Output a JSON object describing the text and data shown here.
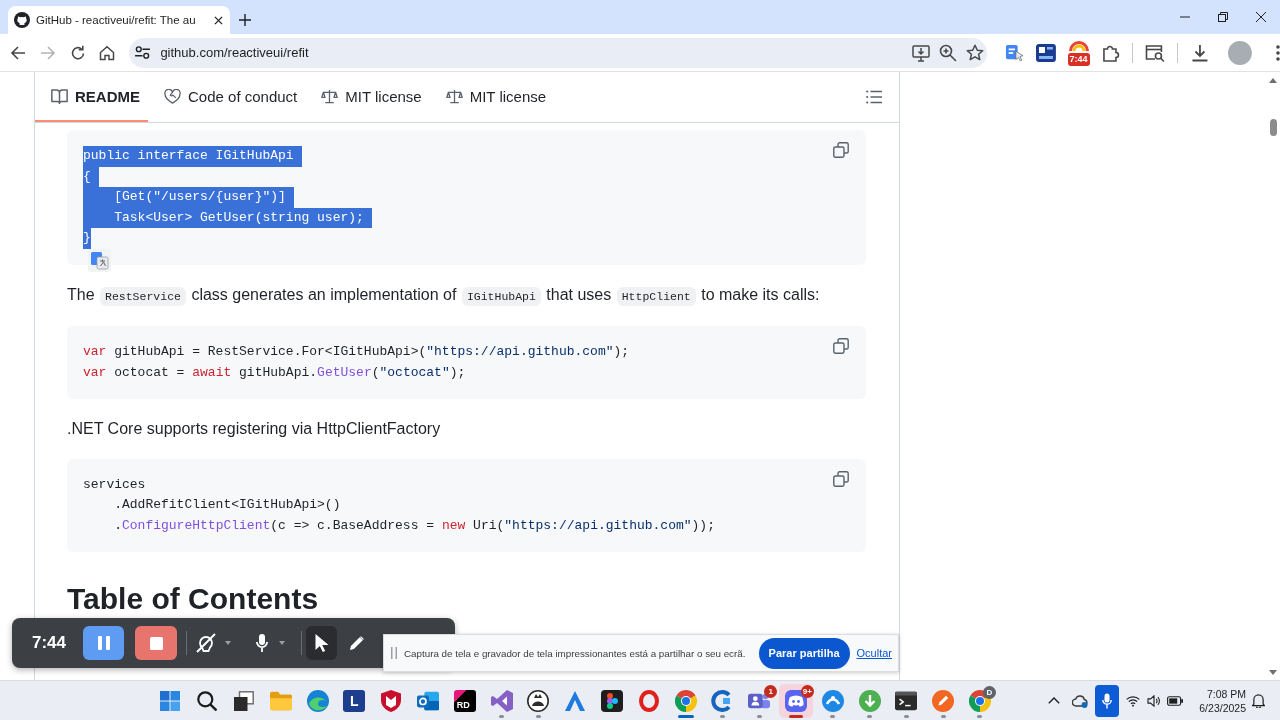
{
  "browser": {
    "tab": {
      "title": "GitHub - reactiveui/refit: The au",
      "selected": true
    },
    "address": "github.com/reactiveui/refit",
    "extension_badge": "7:44"
  },
  "readme": {
    "tabs": [
      {
        "kind": "readme",
        "label": "README",
        "selected": true
      },
      {
        "kind": "conduct",
        "label": "Code of conduct",
        "selected": false
      },
      {
        "kind": "license",
        "label": "MIT license",
        "selected": false
      },
      {
        "kind": "license",
        "label": "MIT license",
        "selected": false
      }
    ],
    "blocks": [
      {
        "kind": "code",
        "highlighted": true,
        "lines": [
          [
            {
              "kind": "plain",
              "text": "public interface IGitHubApi"
            }
          ],
          [
            {
              "kind": "plain",
              "text": "{"
            }
          ],
          [
            {
              "kind": "plain",
              "text": "    [Get(\"/users/{user}\")]"
            }
          ],
          [
            {
              "kind": "plain",
              "text": "    Task<User> GetUser(string user);"
            }
          ],
          [
            {
              "kind": "plain",
              "text": "}"
            }
          ]
        ]
      },
      {
        "kind": "paragraph",
        "segments": [
          {
            "kind": "text",
            "text": "The "
          },
          {
            "kind": "code",
            "text": "RestService"
          },
          {
            "kind": "text",
            "text": " class generates an implementation of "
          },
          {
            "kind": "code",
            "text": "IGitHubApi"
          },
          {
            "kind": "text",
            "text": " that uses "
          },
          {
            "kind": "code",
            "text": "HttpClient"
          },
          {
            "kind": "text",
            "text": " to make its calls:"
          }
        ]
      },
      {
        "kind": "code",
        "highlighted": false,
        "lines": [
          [
            {
              "kind": "keyword",
              "text": "var"
            },
            {
              "kind": "plain",
              "text": " gitHubApi = RestService.For<IGitHubApi>("
            },
            {
              "kind": "string",
              "text": "\"https://api.github.com\""
            },
            {
              "kind": "plain",
              "text": ");"
            }
          ],
          [
            {
              "kind": "keyword",
              "text": "var"
            },
            {
              "kind": "plain",
              "text": " octocat = "
            },
            {
              "kind": "keyword",
              "text": "await"
            },
            {
              "kind": "plain",
              "text": " gitHubApi."
            },
            {
              "kind": "function",
              "text": "GetUser"
            },
            {
              "kind": "plain",
              "text": "("
            },
            {
              "kind": "string",
              "text": "\"octocat\""
            },
            {
              "kind": "plain",
              "text": ");"
            }
          ]
        ]
      },
      {
        "kind": "paragraph",
        "segments": [
          {
            "kind": "text",
            "text": ".NET Core supports registering via HttpClientFactory"
          }
        ]
      },
      {
        "kind": "code",
        "highlighted": false,
        "lines": [
          [
            {
              "kind": "plain",
              "text": "services"
            }
          ],
          [
            {
              "kind": "plain",
              "text": "    .AddRefitClient<IGitHubApi>()"
            }
          ],
          [
            {
              "kind": "plain",
              "text": "    ."
            },
            {
              "kind": "function",
              "text": "ConfigureHttpClient"
            },
            {
              "kind": "plain",
              "text": "(c => c.BaseAddress = "
            },
            {
              "kind": "keyword",
              "text": "new"
            },
            {
              "kind": "plain",
              "text": " Uri("
            },
            {
              "kind": "string",
              "text": "\"https://api.github.com\""
            },
            {
              "kind": "plain",
              "text": "));"
            }
          ]
        ]
      },
      {
        "kind": "heading",
        "text": "Table of Contents"
      }
    ]
  },
  "recorder": {
    "timer": "7:44",
    "camera_on": false,
    "mic_on": true,
    "tools": [
      {
        "kind": "pointer",
        "selected": true
      },
      {
        "kind": "pen",
        "selected": false
      }
    ]
  },
  "share_bar": {
    "message": "Captura de tela e gravador de tela impressionantes está a partilhar o seu ecrã.",
    "stop_button": "Parar partilha",
    "hide_link": "Ocultar"
  },
  "taskbar": {
    "apps": [
      {
        "kind": "start",
        "running": false,
        "active": false,
        "attention": false
      },
      {
        "kind": "search",
        "running": false,
        "active": false,
        "attention": false
      },
      {
        "kind": "taskview",
        "running": false,
        "active": false,
        "attention": false
      },
      {
        "kind": "folder",
        "running": false,
        "active": false,
        "attention": false
      },
      {
        "kind": "wave",
        "running": false,
        "active": false,
        "attention": false
      },
      {
        "kind": "tile",
        "label": "L",
        "running": false,
        "active": false,
        "attention": false
      },
      {
        "kind": "shield",
        "running": false,
        "active": false,
        "attention": false
      },
      {
        "kind": "mail",
        "running": false,
        "active": false,
        "attention": false
      },
      {
        "kind": "ide",
        "label": "RD",
        "running": false,
        "active": false,
        "attention": false
      },
      {
        "kind": "studio",
        "running": true,
        "active": false,
        "attention": false
      },
      {
        "kind": "mascot",
        "running": true,
        "active": false,
        "attention": false
      },
      {
        "kind": "peak",
        "running": false,
        "active": false,
        "attention": false
      },
      {
        "kind": "design",
        "running": false,
        "active": false,
        "attention": false
      },
      {
        "kind": "ring",
        "running": false,
        "active": false,
        "attention": false
      },
      {
        "kind": "browser",
        "running": true,
        "active": true,
        "attention": false
      },
      {
        "kind": "arc",
        "running": true,
        "active": false,
        "attention": false
      },
      {
        "kind": "team",
        "badge": "1",
        "running": true,
        "active": false,
        "attention": false
      },
      {
        "kind": "chat",
        "badge": "9+",
        "running": true,
        "active": false,
        "attention": true
      },
      {
        "kind": "orb",
        "running": true,
        "active": false,
        "attention": false
      },
      {
        "kind": "torrent",
        "running": true,
        "active": false,
        "attention": false
      },
      {
        "kind": "terminal",
        "running": true,
        "active": false,
        "attention": false
      },
      {
        "kind": "brush",
        "running": true,
        "active": false,
        "attention": false
      },
      {
        "kind": "browser",
        "badge": "D",
        "running": true,
        "active": false,
        "attention": false
      }
    ],
    "tray": {
      "mic_active": true,
      "time": "7:08 PM",
      "date": "6/23/2025"
    }
  }
}
